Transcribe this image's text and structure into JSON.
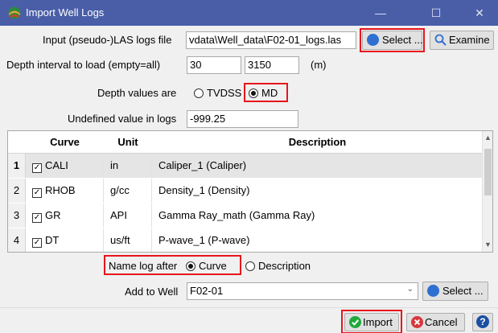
{
  "window": {
    "title": "Import Well Logs",
    "minimize": "—",
    "maximize": "☐",
    "close": "✕"
  },
  "input_file": {
    "label": "Input (pseudo-)LAS logs file",
    "value": "vdata\\Well_data\\F02-01_logs.las",
    "select_label": "Select ...",
    "examine_label": "Examine"
  },
  "depth": {
    "label": "Depth interval to load (empty=all)",
    "from": "30",
    "to": "3150",
    "unit": "(m)"
  },
  "depth_values": {
    "label": "Depth values are",
    "options": [
      "TVDSS",
      "MD"
    ],
    "selected": "MD"
  },
  "undefined": {
    "label": "Undefined value in logs",
    "value": "-999.25"
  },
  "table": {
    "columns": [
      "Curve",
      "Unit",
      "Description"
    ],
    "rows": [
      {
        "num": "1",
        "curve": "CALI",
        "unit": "in",
        "description": "Caliper_1 (Caliper)",
        "checked": true,
        "selected": true
      },
      {
        "num": "2",
        "curve": "RHOB",
        "unit": "g/cc",
        "description": "Density_1 (Density)",
        "checked": true,
        "selected": false
      },
      {
        "num": "3",
        "curve": "GR",
        "unit": "API",
        "description": "Gamma Ray_math (Gamma Ray)",
        "checked": true,
        "selected": false
      },
      {
        "num": "4",
        "curve": "DT",
        "unit": "us/ft",
        "description": "P-wave_1 (P-wave)",
        "checked": true,
        "selected": false
      }
    ]
  },
  "name_log": {
    "label": "Name log after",
    "options": [
      "Curve",
      "Description"
    ],
    "selected": "Curve"
  },
  "well": {
    "label": "Add to Well",
    "value": "F02-01",
    "select_label": "Select ..."
  },
  "footer": {
    "import_label": "Import",
    "cancel_label": "Cancel",
    "help_label": "?"
  },
  "colors": {
    "titlebar": "#4a5ea8",
    "highlight": "#e8141b",
    "select_icon": "#2f6fd1",
    "import_icon": "#1fa83a",
    "cancel_icon": "#d9363e",
    "help_icon": "#1a4fa3"
  }
}
